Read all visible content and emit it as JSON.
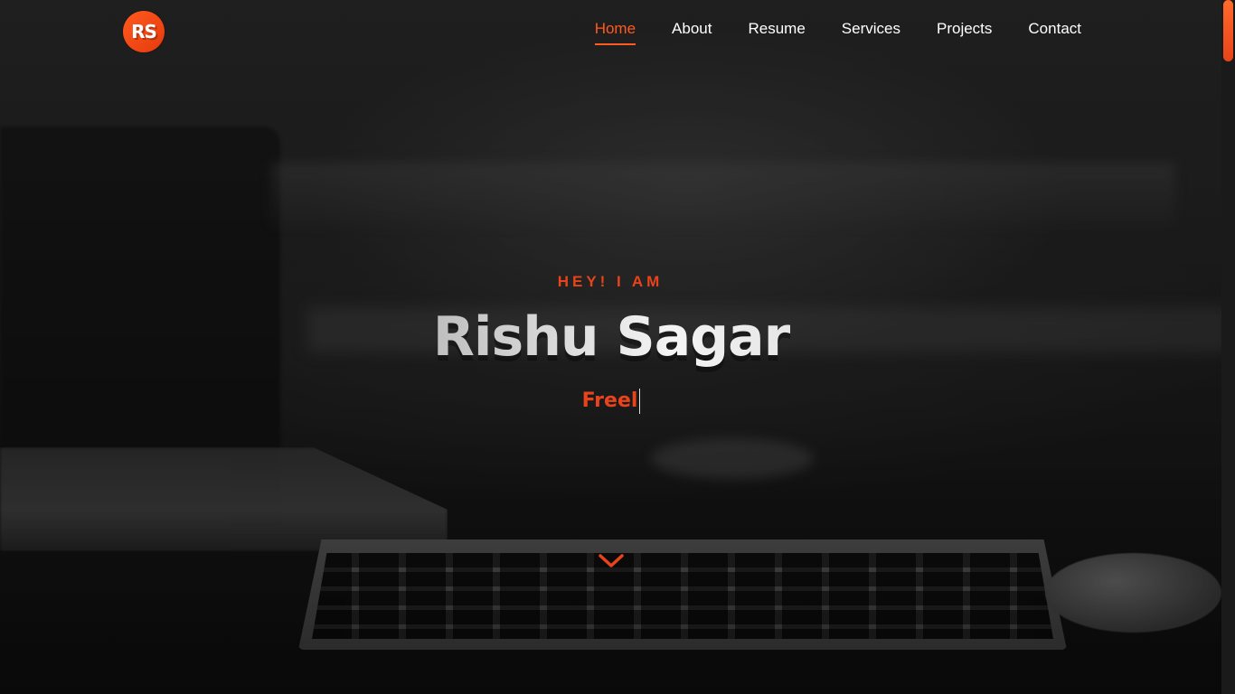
{
  "brand": {
    "logo_text": "RS",
    "accent_color": "#e8431a"
  },
  "nav": {
    "items": [
      {
        "label": "Home",
        "active": true
      },
      {
        "label": "About",
        "active": false
      },
      {
        "label": "Resume",
        "active": false
      },
      {
        "label": "Services",
        "active": false
      },
      {
        "label": "Projects",
        "active": false
      },
      {
        "label": "Contact",
        "active": false
      }
    ]
  },
  "hero": {
    "eyebrow": "HEY! I AM",
    "name": "Rishu Sagar",
    "typed_text": "Freel",
    "scroll_icon": "chevron-down-icon"
  }
}
